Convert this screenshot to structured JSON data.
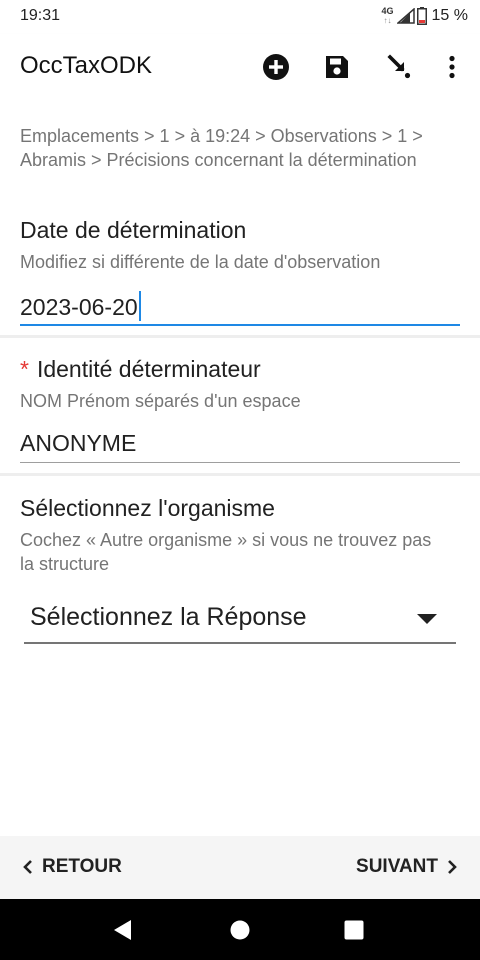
{
  "status_bar": {
    "time": "19:31",
    "network": "4G",
    "battery": "15 %"
  },
  "app_bar": {
    "title": "OccTaxODK",
    "actions": [
      "add-circle-icon",
      "save-icon",
      "go-to-icon",
      "more-vert-icon"
    ]
  },
  "form": {
    "breadcrumb": "Emplacements > 1 > à 19:24 > Observations > 1 > Abramis > Précisions concernant la détermination",
    "questions": [
      {
        "label": "Date de détermination",
        "hint": "Modifiez si différente de la date d'observation",
        "value": "2023-06-20",
        "required": false
      },
      {
        "label": "Identité déterminateur",
        "hint": "NOM Prénom séparés d'un espace",
        "value": "ANONYME",
        "required": true,
        "required_marker": "*"
      },
      {
        "label": "Sélectionnez l'organisme",
        "hint": "Cochez « Autre organisme » si vous ne trouvez pas la structure",
        "select_value": "Sélectionnez la Réponse",
        "required": false
      }
    ]
  },
  "bottom_nav": {
    "back_label": "RETOUR",
    "next_label": "SUIVANT"
  },
  "colors": {
    "accent": "#1e88e5",
    "required": "#e53935",
    "hint_text": "#757575",
    "bottom_bar_bg": "#f5f5f5",
    "system_nav_bg": "#000000"
  }
}
